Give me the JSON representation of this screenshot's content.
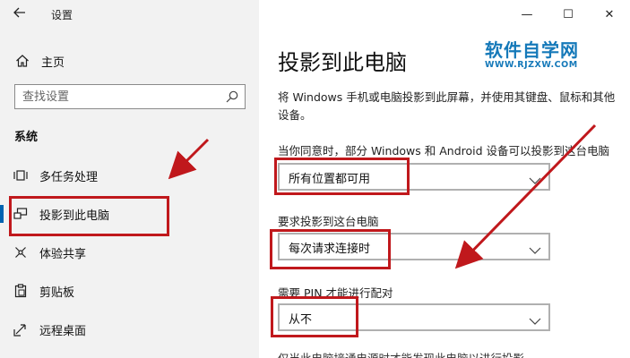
{
  "window": {
    "title": "设置",
    "controls": {
      "minimize": "—",
      "maximize": "☐",
      "close": "✕"
    }
  },
  "sidebar": {
    "home_label": "主页",
    "search_placeholder": "查找设置",
    "section_label": "系统",
    "items": [
      {
        "label": "多任务处理",
        "icon": "multitasking-icon"
      },
      {
        "label": "投影到此电脑",
        "icon": "project-to-pc-icon",
        "active": true
      },
      {
        "label": "体验共享",
        "icon": "shared-experiences-icon"
      },
      {
        "label": "剪贴板",
        "icon": "clipboard-icon"
      },
      {
        "label": "远程桌面",
        "icon": "remote-desktop-icon"
      }
    ]
  },
  "main": {
    "title": "投影到此电脑",
    "description": "将 Windows 手机或电脑投影到此屏幕，并使用其键盘、鼠标和其他设备。",
    "settings": [
      {
        "label": "当你同意时，部分 Windows 和 Android 设备可以投影到这台电脑",
        "value": "所有位置都可用"
      },
      {
        "label": "要求投影到这台电脑",
        "value": "每次请求连接时"
      },
      {
        "label": "需要 PIN 才能进行配对",
        "value": "从不"
      }
    ],
    "partial_text": "仅当此电脑接通电源时才能发现此电脑以进行投影"
  },
  "watermark": {
    "name": "软件自学网",
    "url": "WWW.RJZXW.COM"
  },
  "colors": {
    "highlight": "#c0181c",
    "accent": "#0063b1",
    "watermark": "#1579b9",
    "sidebar_bg": "#f2f2f2"
  }
}
